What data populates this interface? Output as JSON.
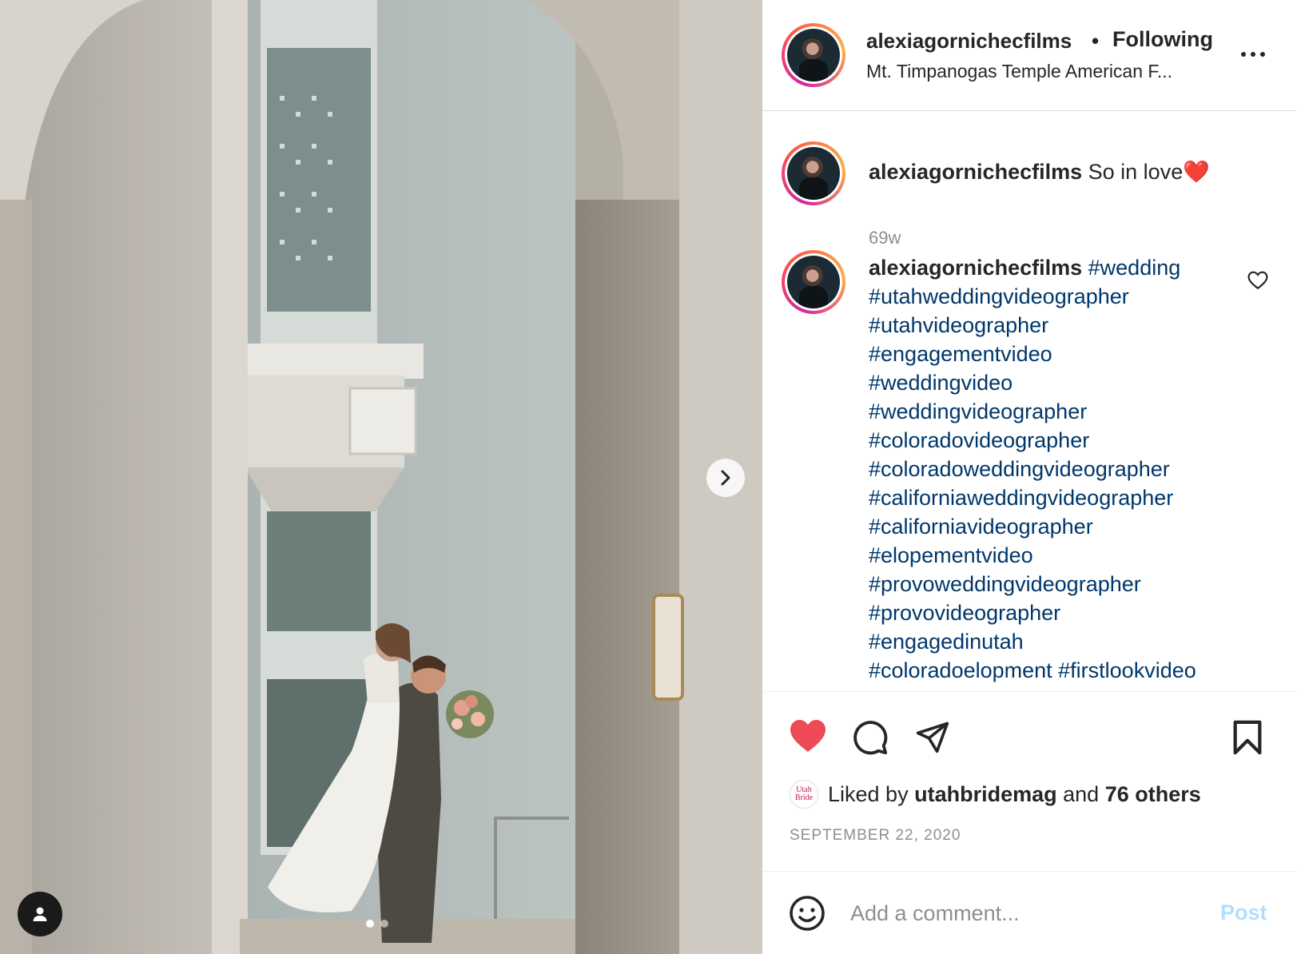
{
  "post": {
    "username": "alexiagornichecfilms",
    "follow_status": "Following",
    "separator": "•",
    "location": "Mt. Timpanogas Temple American F...",
    "caption": {
      "username": "alexiagornichecfilms",
      "text": "So in love❤️",
      "time": "69w"
    },
    "hashtag_comment": {
      "username": "alexiagornichecfilms",
      "hashtags": [
        "#wedding",
        "#utahweddingvideographer",
        "#utahvideographer",
        "#engagementvideo",
        "#weddingvideo",
        "#weddingvideographer",
        "#coloradovideographer",
        "#coloradoweddingvideographer",
        "#californiaweddingvideographer",
        "#californiavideographer",
        "#elopementvideo",
        "#provoweddingvideographer",
        "#provovideographer",
        "#engagedinutah",
        "#coloradoelopment #firstlookvideo"
      ]
    },
    "likes": {
      "prefix": "Liked by",
      "user": "utahbridemag",
      "conjunction": "and",
      "others": "76 others",
      "liker_avatar_text": [
        "Utah",
        "Bride"
      ]
    },
    "date": "SEPTEMBER 22, 2020",
    "comment_box": {
      "placeholder": "Add a comment...",
      "post_label": "Post"
    },
    "carousel": {
      "current": 1,
      "total": 2
    }
  },
  "icons": {
    "like": "heart-filled-icon",
    "comment": "comment-bubble-icon",
    "share": "paper-plane-icon",
    "save": "bookmark-icon",
    "emoji": "smiley-icon",
    "more": "ellipsis-icon",
    "next": "chevron-right-icon",
    "tagged_users": "person-icon"
  },
  "colors": {
    "like_red": "#ed4956",
    "hashtag_blue": "#00376b",
    "post_button_disabled": "#b2dffc",
    "secondary_text": "#8e8e8e"
  }
}
